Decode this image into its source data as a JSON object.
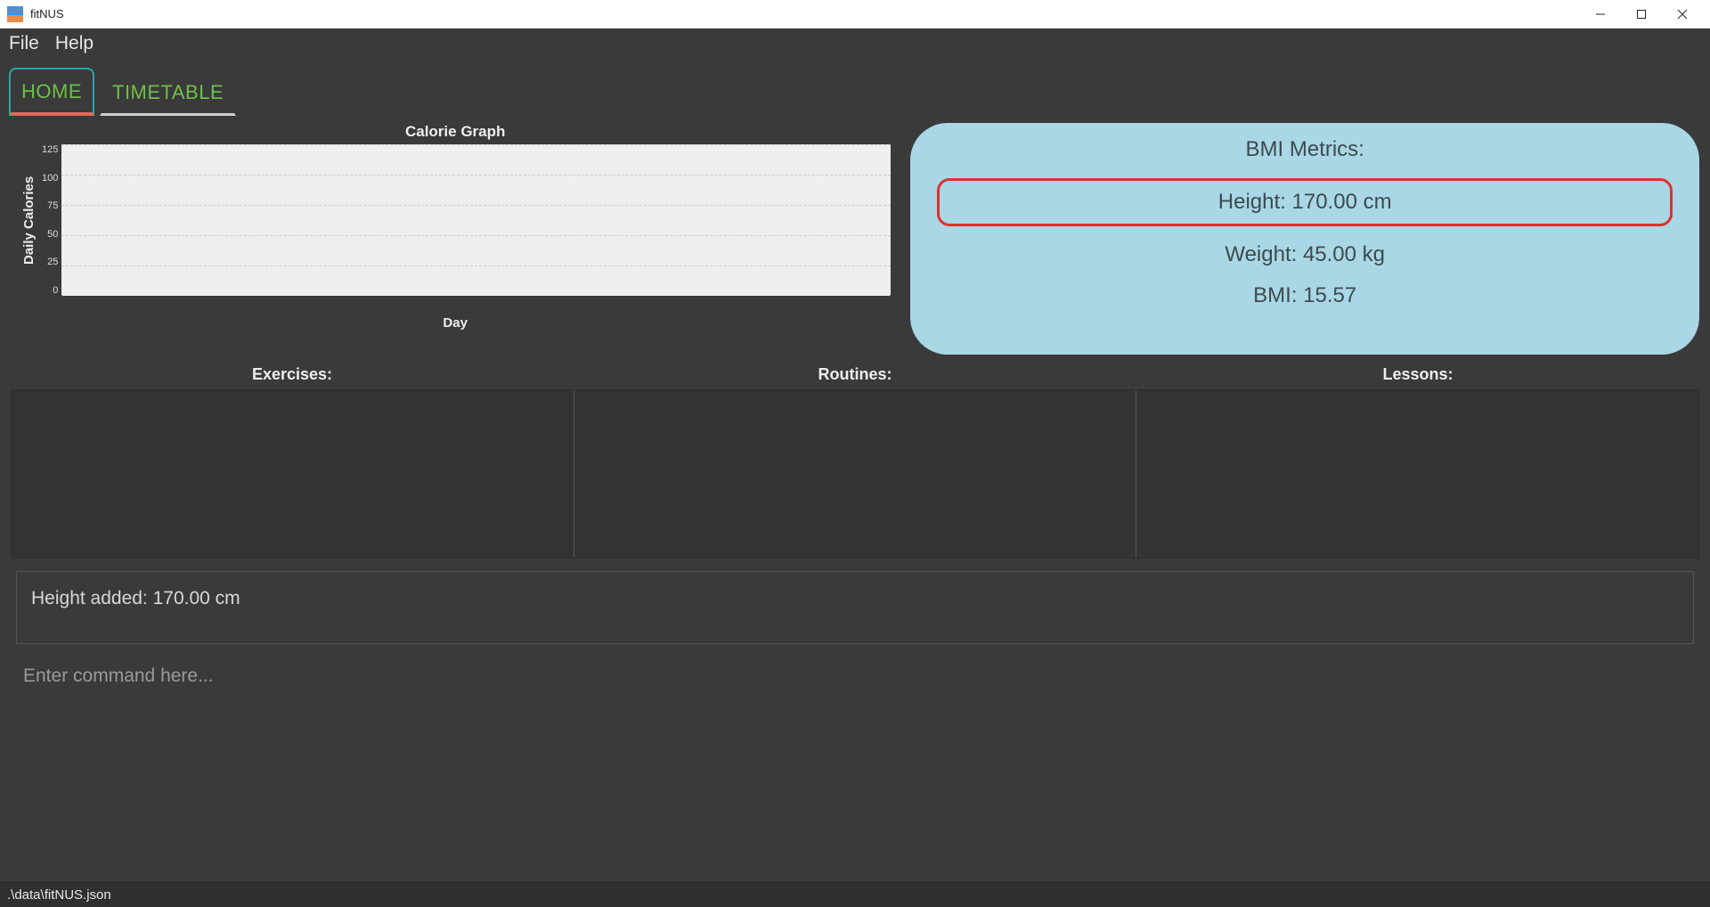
{
  "window": {
    "title": "fitNUS"
  },
  "menu": {
    "file": "File",
    "help": "Help"
  },
  "tabs": {
    "home": "HOME",
    "timetable": "TIMETABLE"
  },
  "chart_data": {
    "type": "bar",
    "title": "Calorie Graph",
    "xlabel": "Day",
    "ylabel": "Daily Calories",
    "categories": [],
    "values": [],
    "ylim": [
      0,
      125
    ],
    "yticks": [
      0,
      25,
      50,
      75,
      100,
      125
    ]
  },
  "bmi": {
    "title": "BMI Metrics:",
    "height_label": "Height: 170.00 cm",
    "weight_label": "Weight: 45.00 kg",
    "bmi_label": "BMI: 15.57"
  },
  "lists": {
    "exercises_header": "Exercises:",
    "routines_header": "Routines:",
    "lessons_header": "Lessons:"
  },
  "feedback": {
    "message": "Height added: 170.00 cm"
  },
  "command": {
    "placeholder": "Enter command here..."
  },
  "statusbar": {
    "path": ".\\data\\fitNUS.json"
  }
}
